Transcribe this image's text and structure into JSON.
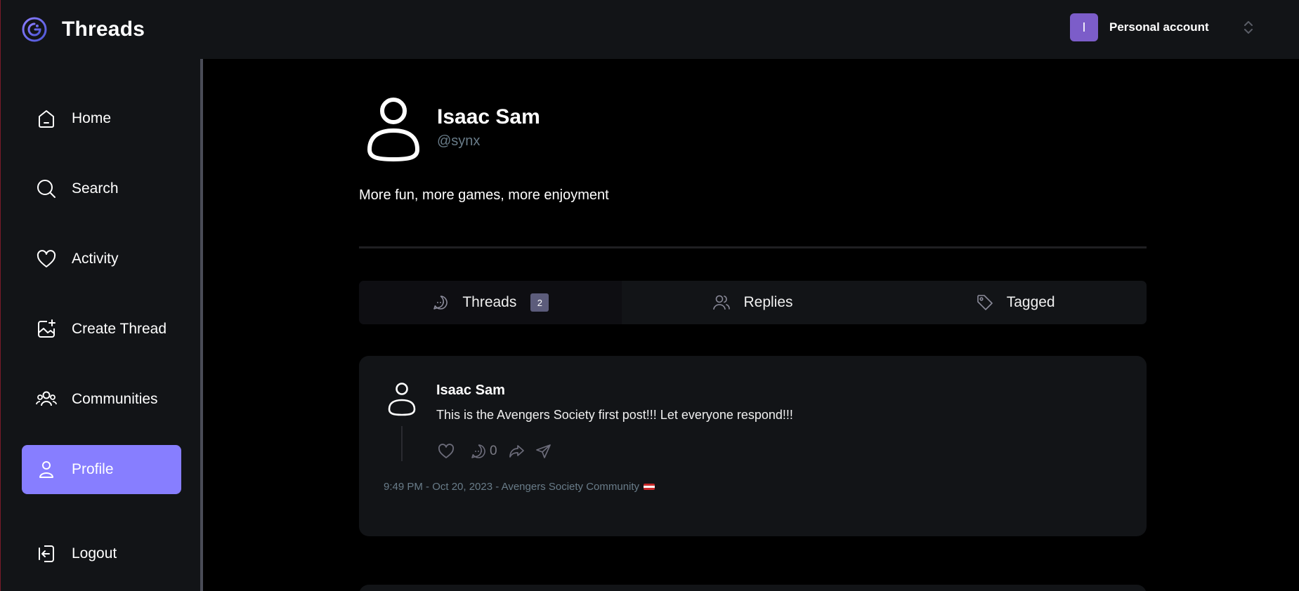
{
  "app": {
    "title": "Threads"
  },
  "account": {
    "initial": "I",
    "label": "Personal account"
  },
  "sidebar": {
    "items": [
      {
        "label": "Home",
        "icon": "home-icon"
      },
      {
        "label": "Search",
        "icon": "search-icon"
      },
      {
        "label": "Activity",
        "icon": "heart-icon"
      },
      {
        "label": "Create Thread",
        "icon": "image-plus-icon"
      },
      {
        "label": "Communities",
        "icon": "community-icon"
      },
      {
        "label": "Profile",
        "icon": "user-icon",
        "active": true
      }
    ],
    "logout": {
      "label": "Logout",
      "icon": "logout-icon"
    }
  },
  "profile": {
    "name": "Isaac Sam",
    "handle": "@synx",
    "bio": "More fun, more games, more enjoyment"
  },
  "tabs": [
    {
      "label": "Threads",
      "icon": "chat-bubble-icon",
      "badge": "2",
      "active": true
    },
    {
      "label": "Replies",
      "icon": "users-icon"
    },
    {
      "label": "Tagged",
      "icon": "tag-icon"
    }
  ],
  "posts": [
    {
      "author": "Isaac Sam",
      "text": "This is the Avengers Society first post!!! Let everyone respond!!!",
      "reply_count": "0",
      "meta": "9:49 PM - Oct 20, 2023 - Avengers Society Community"
    }
  ],
  "colors": {
    "accent": "#877eff",
    "surface": "#121417",
    "background": "#000000",
    "muted": "#697c89",
    "account_avatar": "#7c5dc9"
  }
}
